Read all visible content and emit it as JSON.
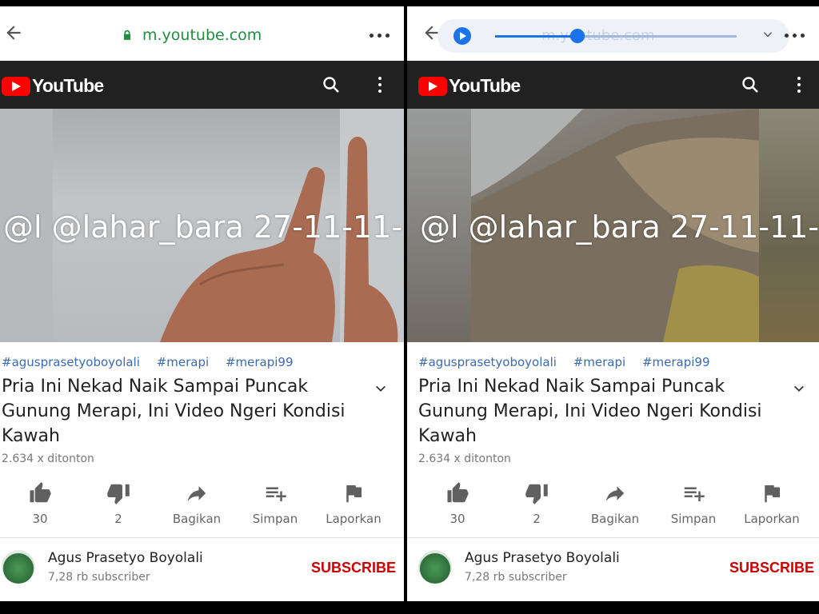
{
  "left": {
    "browser": {
      "url": "m.youtube.com"
    },
    "header": {
      "brand": "YouTube"
    },
    "video": {
      "overlay_text": "@l @lahar_bara 27-11-11-",
      "hashtags": [
        "#agusprasetyoboyolali",
        "#merapi",
        "#merapi99"
      ],
      "title": "Pria Ini Nekad Naik Sampai Puncak Gunung Merapi, Ini Video Ngeri Kondisi Kawah",
      "views": "2.634 x ditonton"
    },
    "actions": {
      "like": "30",
      "dislike": "2",
      "share": "Bagikan",
      "save": "Simpan",
      "report": "Laporkan"
    },
    "channel": {
      "name": "Agus Prasetyo Boyolali",
      "subscribers": "7,28 rb subscriber",
      "subscribe": "SUBSCRIBE"
    }
  },
  "right": {
    "player": {
      "ghost_url": "m.youtube.com",
      "progress": 0.34
    },
    "header": {
      "brand": "YouTube"
    },
    "video": {
      "overlay_text": "@l @lahar_bara 27-11-11-",
      "hashtags": [
        "#agusprasetyoboyolali",
        "#merapi",
        "#merapi99"
      ],
      "title": "Pria Ini Nekad Naik Sampai Puncak Gunung Merapi, Ini Video Ngeri Kondisi Kawah",
      "views": "2.634 x ditonton"
    },
    "actions": {
      "like": "30",
      "dislike": "2",
      "share": "Bagikan",
      "save": "Simpan",
      "report": "Laporkan"
    },
    "channel": {
      "name": "Agus Prasetyo Boyolali",
      "subscribers": "7,28 rb subscriber",
      "subscribe": "SUBSCRIBE"
    }
  },
  "colors": {
    "youtube_red": "#ff0000",
    "header_bg": "#212121",
    "hashtag": "#3a6ab3",
    "subscribe": "#cc0000",
    "url_green": "#1e8e3e"
  },
  "icons": [
    "back-arrow-icon",
    "lock-icon",
    "more-dots-icon",
    "play-icon",
    "chevron-down-icon",
    "search-icon",
    "kebab-menu-icon",
    "thumbs-up-icon",
    "thumbs-down-icon",
    "share-icon",
    "playlist-add-icon",
    "flag-icon"
  ]
}
